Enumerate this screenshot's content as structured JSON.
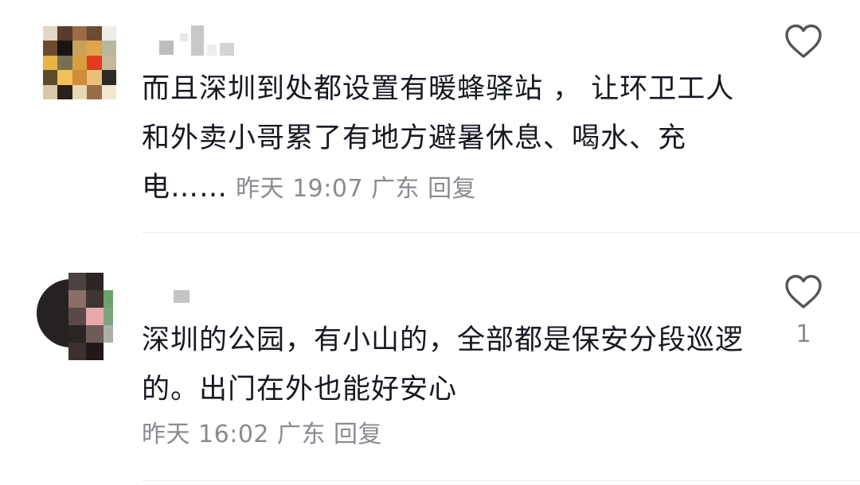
{
  "comments": [
    {
      "text": "而且深圳到处都设置有暖蜂驿站 ， 让环卫工人和外卖小哥累了有地方避暑休息、喝水、充电……",
      "time": "昨天 19:07",
      "location": "广东",
      "reply_label": "回复",
      "like_icon": "heart-outline-icon",
      "like_count": ""
    },
    {
      "text": "深圳的公园，有小山的，全部都是保安分段巡逻的。出门在外也能好安心",
      "time": "昨天 16:02",
      "location": "广东",
      "reply_label": "回复",
      "like_icon": "heart-outline-icon",
      "like_count": "1"
    }
  ],
  "colors": {
    "text": "#161823",
    "meta": "#8a8b91",
    "divider": "#ececec",
    "icon": "#555555"
  }
}
